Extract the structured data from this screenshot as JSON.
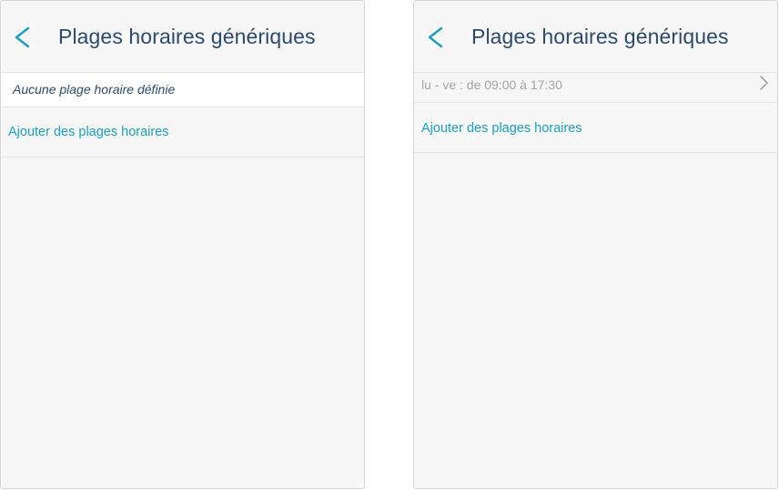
{
  "left_screen": {
    "back_icon": "chevron-left-icon",
    "title": "Plages horaires génériques",
    "empty_message": "Aucune plage horaire définie",
    "add_label": "Ajouter des plages horaires"
  },
  "right_screen": {
    "back_icon": "chevron-left-icon",
    "title": "Plages horaires génériques",
    "slots": [
      {
        "label": "lu - ve : de 09:00 à 17:30",
        "icon": "chevron-right-icon"
      }
    ],
    "add_label": "Ajouter des plages horaires"
  },
  "colors": {
    "accent": "#1a9fbf",
    "title": "#2c4a6b",
    "muted": "#a3a3a3",
    "background": "#f7f7f7",
    "divider": "#e3e3e3"
  }
}
